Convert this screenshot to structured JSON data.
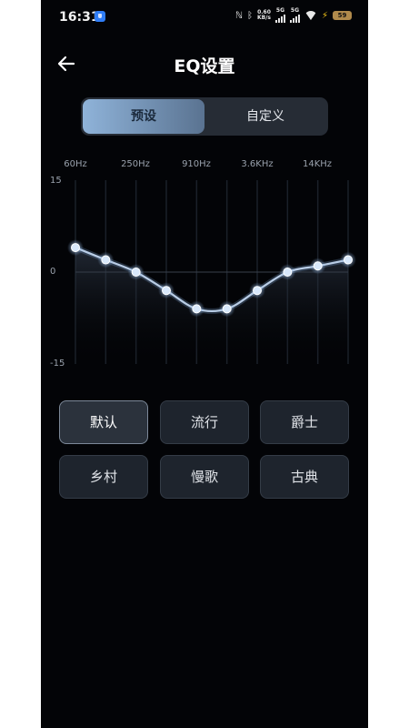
{
  "status_bar": {
    "time": "16:31",
    "net_speed_value": "0.60",
    "net_speed_unit": "KB/s",
    "sim1_label": "5G",
    "sim2_label": "5G",
    "battery_level": "59",
    "icons": [
      "shield-icon",
      "nfc-icon",
      "bluetooth-icon",
      "signal-icon",
      "wifi-icon",
      "charging-bolt-icon",
      "battery-icon"
    ]
  },
  "header": {
    "title": "EQ设置",
    "back_icon": "arrow-left-icon"
  },
  "tabs": [
    {
      "label": "预设",
      "active": true
    },
    {
      "label": "自定义",
      "active": false
    }
  ],
  "chart_data": {
    "type": "line",
    "x_labels": [
      "60Hz",
      "250Hz",
      "910Hz",
      "3.6KHz",
      "14KHz"
    ],
    "y_ticks": [
      "15",
      "0",
      "-15"
    ],
    "ylim": [
      -15,
      15
    ],
    "band_count": 10,
    "series": [
      {
        "values": [
          4,
          2,
          0,
          -3,
          -6,
          -6,
          -3,
          0,
          1,
          2
        ]
      }
    ],
    "colors": {
      "line": "#b9cde6",
      "point": "#d8e8fb",
      "glow": "#7fa8d8"
    }
  },
  "presets": [
    {
      "label": "默认",
      "active": true
    },
    {
      "label": "流行",
      "active": false
    },
    {
      "label": "爵士",
      "active": false
    },
    {
      "label": "乡村",
      "active": false
    },
    {
      "label": "慢歌",
      "active": false
    },
    {
      "label": "古典",
      "active": false
    }
  ]
}
